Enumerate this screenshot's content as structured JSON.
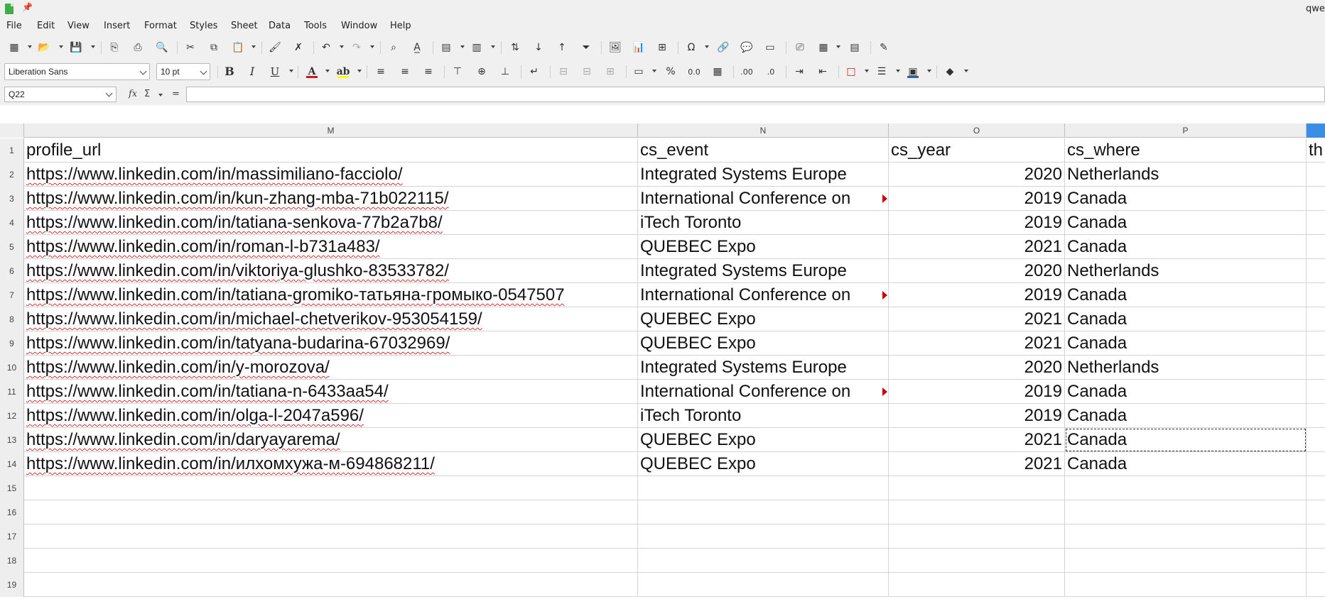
{
  "window": {
    "title": "qwe"
  },
  "menu": [
    "File",
    "Edit",
    "View",
    "Insert",
    "Format",
    "Styles",
    "Sheet",
    "Data",
    "Tools",
    "Window",
    "Help"
  ],
  "toolbar": {
    "font_name": "Liberation Sans",
    "font_size": "10 pt",
    "bold_label": "B",
    "italic_label": "I",
    "underline_label": "U",
    "percent_label": "%",
    "number_label": "0.0",
    "add_decimal_label": ".00",
    "del_decimal_label": ".0"
  },
  "formula_bar": {
    "cell_reference": "Q22",
    "formula": ""
  },
  "grid": {
    "columns": [
      "M",
      "N",
      "O",
      "P",
      ""
    ],
    "header_row": [
      "profile_url",
      "cs_event",
      "cs_year",
      "cs_where",
      "th"
    ],
    "rows": [
      {
        "num": "1",
        "url": "profile_url",
        "event": "cs_event",
        "year": "cs_year",
        "where": "cs_where",
        "extra": "th",
        "header": true
      },
      {
        "num": "2",
        "url": "https://www.linkedin.com/in/massimiliano-facciolo/",
        "event": "Integrated Systems Europe",
        "year": "2020",
        "where": "Netherlands"
      },
      {
        "num": "3",
        "url": "https://www.linkedin.com/in/kun-zhang-mba-71b022115/",
        "event": "International Conference on",
        "year": "2019",
        "where": "Canada",
        "overflow": true
      },
      {
        "num": "4",
        "url": "https://www.linkedin.com/in/tatiana-senkova-77b2a7b8/",
        "event": "iTech Toronto",
        "year": "2019",
        "where": "Canada"
      },
      {
        "num": "5",
        "url": "https://www.linkedin.com/in/roman-l-b731a483/",
        "event": "QUEBEC Expo",
        "year": "2021",
        "where": "Canada"
      },
      {
        "num": "6",
        "url": "https://www.linkedin.com/in/viktoriya-glushko-83533782/",
        "event": "Integrated Systems Europe",
        "year": "2020",
        "where": "Netherlands"
      },
      {
        "num": "7",
        "url": "https://www.linkedin.com/in/tatiana-gromiko-татьяна-громыко-0547507",
        "event": "International Conference on",
        "year": "2019",
        "where": "Canada",
        "overflow": true
      },
      {
        "num": "8",
        "url": "https://www.linkedin.com/in/michael-chetverikov-953054159/",
        "event": "QUEBEC Expo",
        "year": "2021",
        "where": "Canada"
      },
      {
        "num": "9",
        "url": "https://www.linkedin.com/in/tatyana-budarina-67032969/",
        "event": "QUEBEC Expo",
        "year": "2021",
        "where": "Canada"
      },
      {
        "num": "10",
        "url": "https://www.linkedin.com/in/y-morozova/",
        "event": "Integrated Systems Europe",
        "year": "2020",
        "where": "Netherlands"
      },
      {
        "num": "11",
        "url": "https://www.linkedin.com/in/tatiana-n-6433aa54/",
        "event": "International Conference on",
        "year": "2019",
        "where": "Canada",
        "overflow": true
      },
      {
        "num": "12",
        "url": "https://www.linkedin.com/in/olga-l-2047a596/",
        "event": "iTech Toronto",
        "year": "2019",
        "where": "Canada"
      },
      {
        "num": "13",
        "url": "https://www.linkedin.com/in/daryayarema/",
        "event": "QUEBEC Expo",
        "year": "2021",
        "where": "Canada",
        "marked": true
      },
      {
        "num": "14",
        "url": "https://www.linkedin.com/in/илхомхужа-м-694868211/",
        "event": "QUEBEC Expo",
        "year": "2021",
        "where": "Canada"
      },
      {
        "num": "15",
        "url": "",
        "event": "",
        "year": "",
        "where": ""
      },
      {
        "num": "16",
        "url": "",
        "event": "",
        "year": "",
        "where": ""
      },
      {
        "num": "17",
        "url": "",
        "event": "",
        "year": "",
        "where": ""
      },
      {
        "num": "18",
        "url": "",
        "event": "",
        "year": "",
        "where": ""
      },
      {
        "num": "19",
        "url": "",
        "event": "",
        "year": "",
        "where": ""
      }
    ]
  }
}
